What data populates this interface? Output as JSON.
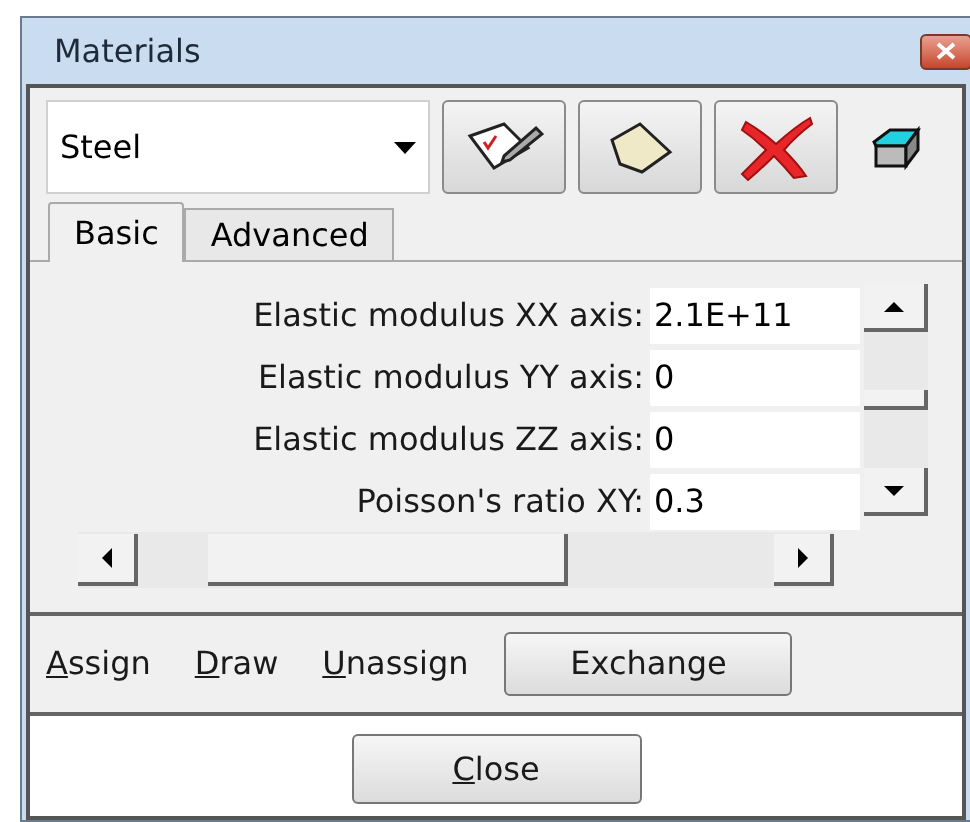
{
  "window": {
    "title": "Materials"
  },
  "material_select": {
    "value": "Steel"
  },
  "tabs": [
    {
      "label": "Basic",
      "selected": true
    },
    {
      "label": "Advanced",
      "selected": false
    }
  ],
  "properties": [
    {
      "label": "Elastic modulus XX axis:",
      "value": "2.1E+11"
    },
    {
      "label": "Elastic modulus YY axis:",
      "value": "0"
    },
    {
      "label": "Elastic modulus ZZ axis:",
      "value": "0"
    },
    {
      "label": "Poisson's ratio XY:",
      "value": "0.3"
    }
  ],
  "actions": [
    {
      "kind": "link",
      "label": "Assign",
      "underline_first": true
    },
    {
      "kind": "link",
      "label": "Draw",
      "underline_first": true
    },
    {
      "kind": "link",
      "label": "Unassign",
      "underline_first": true
    },
    {
      "kind": "button",
      "label": "Exchange",
      "underline_first": false
    }
  ],
  "close_button": {
    "label": "Close",
    "underline_first": true
  }
}
